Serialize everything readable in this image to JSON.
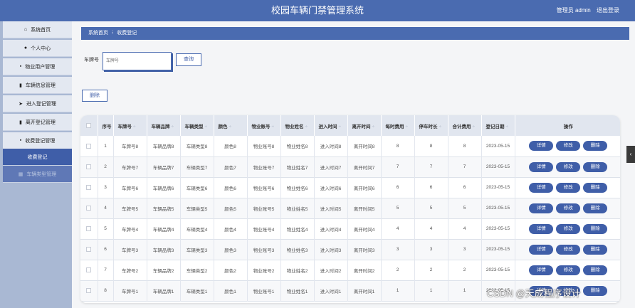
{
  "header": {
    "title": "校园车辆门禁管理系统",
    "user_label": "管理员 admin",
    "logout_label": "退出登录"
  },
  "sidebar": {
    "items": [
      {
        "label": "系统首页",
        "icon": "home-icon",
        "glyph": "⌂"
      },
      {
        "label": "个人中心",
        "icon": "user-icon",
        "glyph": "●"
      },
      {
        "label": "物业用户管理",
        "icon": "grid-icon",
        "glyph": "▪"
      },
      {
        "label": "车辆信息管理",
        "icon": "bar-chart-icon",
        "glyph": "▮"
      },
      {
        "label": "进入登记管理",
        "icon": "send-icon",
        "glyph": "➤"
      },
      {
        "label": "离开登记管理",
        "icon": "file-icon",
        "glyph": "▮"
      },
      {
        "label": "收费登记管理",
        "icon": "grid-icon",
        "glyph": "▪"
      }
    ],
    "sub_items": [
      {
        "label": "收费登记"
      },
      {
        "label": "车辆类型管理",
        "glyph": "▦"
      }
    ]
  },
  "breadcrumb": {
    "home": "系统首页",
    "separator": "⁝",
    "current": "收费登记"
  },
  "search": {
    "label": "车牌号",
    "placeholder": "车牌号",
    "button": "查询"
  },
  "toolbar": {
    "delete_label": "删除"
  },
  "table": {
    "sort_glyph": "÷",
    "headers": [
      "序号",
      "车牌号",
      "车辆品牌",
      "车辆类型",
      "颜色",
      "物业账号",
      "物业姓名",
      "进入时间",
      "离开时间",
      "每时费用",
      "停车时长",
      "合计费用",
      "登记日期",
      "操作"
    ],
    "actions": [
      "详情",
      "修改",
      "删除"
    ],
    "rows": [
      {
        "no": "1",
        "plate": "车牌号8",
        "brand": "车辆品牌8",
        "type": "车辆类型8",
        "color": "颜色8",
        "account": "物业账号8",
        "name": "物业姓名8",
        "in": "进入时间8",
        "out": "离开时间8",
        "rate": "8",
        "hours": "8",
        "total": "8",
        "date": "2023-05-15"
      },
      {
        "no": "2",
        "plate": "车牌号7",
        "brand": "车辆品牌7",
        "type": "车辆类型7",
        "color": "颜色7",
        "account": "物业账号7",
        "name": "物业姓名7",
        "in": "进入时间7",
        "out": "离开时间7",
        "rate": "7",
        "hours": "7",
        "total": "7",
        "date": "2023-05-15"
      },
      {
        "no": "3",
        "plate": "车牌号6",
        "brand": "车辆品牌6",
        "type": "车辆类型6",
        "color": "颜色6",
        "account": "物业账号6",
        "name": "物业姓名6",
        "in": "进入时间6",
        "out": "离开时间6",
        "rate": "6",
        "hours": "6",
        "total": "6",
        "date": "2023-05-15"
      },
      {
        "no": "4",
        "plate": "车牌号5",
        "brand": "车辆品牌5",
        "type": "车辆类型5",
        "color": "颜色5",
        "account": "物业账号5",
        "name": "物业姓名5",
        "in": "进入时间5",
        "out": "离开时间5",
        "rate": "5",
        "hours": "5",
        "total": "5",
        "date": "2023-05-15"
      },
      {
        "no": "5",
        "plate": "车牌号4",
        "brand": "车辆品牌4",
        "type": "车辆类型4",
        "color": "颜色4",
        "account": "物业账号4",
        "name": "物业姓名4",
        "in": "进入时间4",
        "out": "离开时间4",
        "rate": "4",
        "hours": "4",
        "total": "4",
        "date": "2023-05-15"
      },
      {
        "no": "6",
        "plate": "车牌号3",
        "brand": "车辆品牌3",
        "type": "车辆类型3",
        "color": "颜色3",
        "account": "物业账号3",
        "name": "物业姓名3",
        "in": "进入时间3",
        "out": "离开时间3",
        "rate": "3",
        "hours": "3",
        "total": "3",
        "date": "2023-05-15"
      },
      {
        "no": "7",
        "plate": "车牌号2",
        "brand": "车辆品牌2",
        "type": "车辆类型2",
        "color": "颜色2",
        "account": "物业账号2",
        "name": "物业姓名2",
        "in": "进入时间2",
        "out": "离开时间2",
        "rate": "2",
        "hours": "2",
        "total": "2",
        "date": "2023-05-15"
      },
      {
        "no": "8",
        "plate": "车牌号1",
        "brand": "车辆品牌1",
        "type": "车辆类型1",
        "color": "颜色1",
        "account": "物业账号1",
        "name": "物业姓名1",
        "in": "进入时间1",
        "out": "离开时间1",
        "rate": "1",
        "hours": "1",
        "total": "1",
        "date": "2023-05-15"
      }
    ]
  },
  "side_handle": "‹",
  "watermark": "CSDN @天成程序设计",
  "colors": {
    "primary": "#4a6bb0",
    "button": "#3f5ea8",
    "sidebar_bg": "#a9b8d3",
    "menu_bg": "#e3e8f1"
  }
}
